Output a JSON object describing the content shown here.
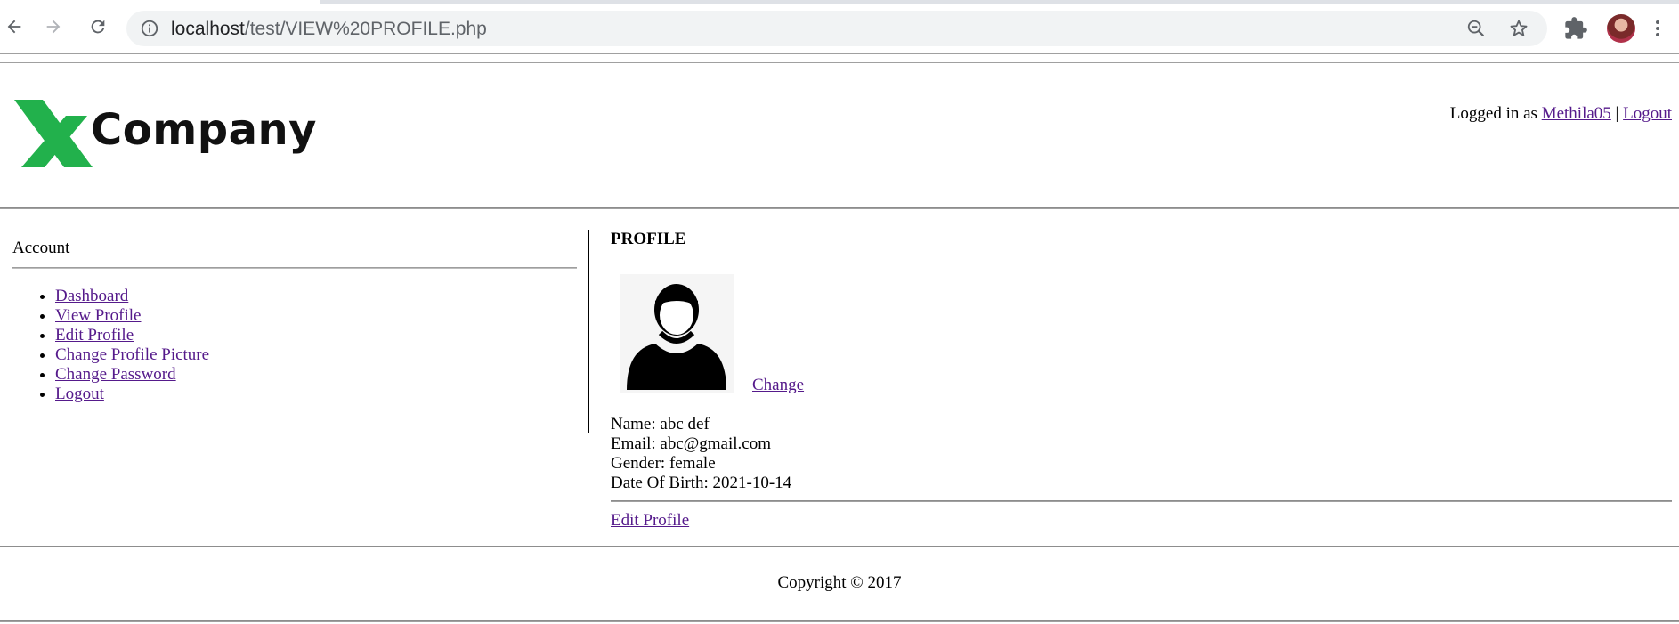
{
  "browser": {
    "url_host": "localhost",
    "url_path": "/test/VIEW%20PROFILE.php"
  },
  "header": {
    "logo_text": "Company",
    "logged_in_prefix": "Logged in as",
    "username": "Methila05",
    "separator": "|",
    "logout": "Logout"
  },
  "sidebar": {
    "title": "Account",
    "items": [
      {
        "label": "Dashboard"
      },
      {
        "label": "View Profile"
      },
      {
        "label": "Edit Profile"
      },
      {
        "label": "Change Profile Picture"
      },
      {
        "label": "Change Password"
      },
      {
        "label": "Logout"
      }
    ]
  },
  "profile": {
    "title": "PROFILE",
    "change_label": "Change",
    "name": "Name: abc def",
    "email": "Email: abc@gmail.com",
    "gender": "Gender: female",
    "dob": "Date Of Birth: 2021-10-14",
    "edit_label": "Edit Profile"
  },
  "footer": {
    "copyright": "Copyright © 2017"
  },
  "colors": {
    "link": "#551a8b",
    "logo_x": "#22b14c"
  }
}
